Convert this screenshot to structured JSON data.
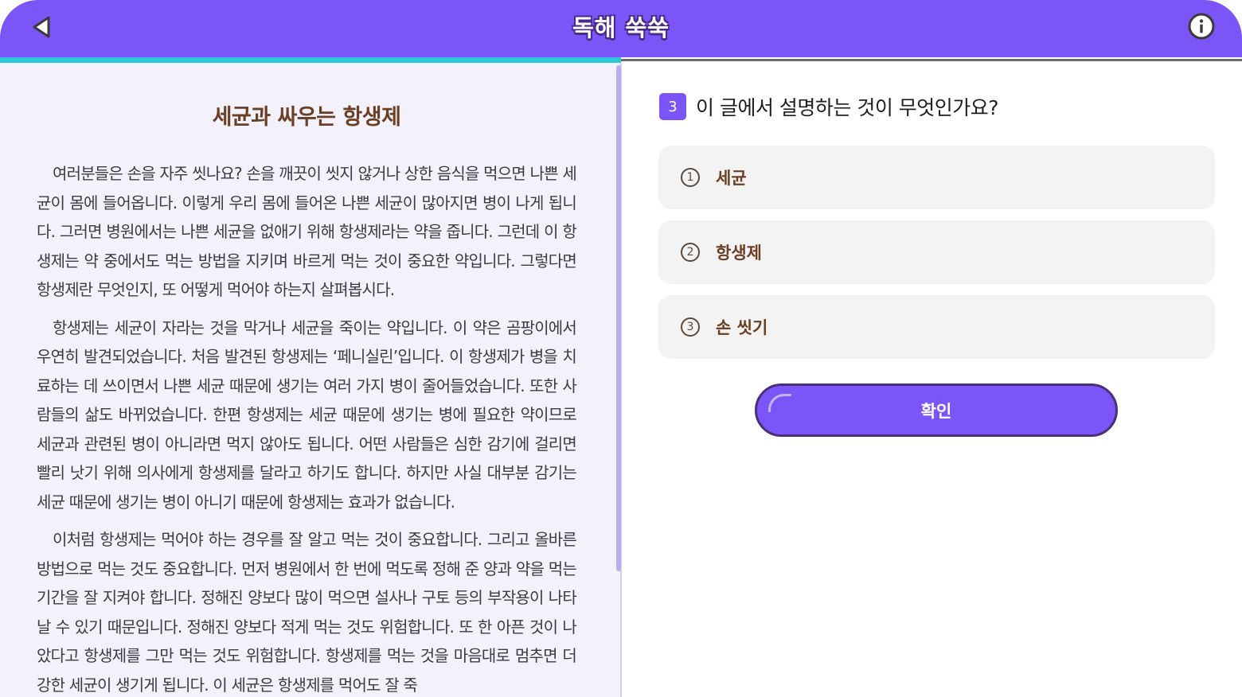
{
  "header": {
    "title": "독해 쑥쑥",
    "back_icon": "back-arrow-icon",
    "info_icon": "info-icon"
  },
  "progress": {
    "fraction": 0.5
  },
  "colors": {
    "accent": "#7b55f8",
    "progress": "#2ec9d9",
    "passage_title": "#6b3f23",
    "passage_bg": "#f3f1fb"
  },
  "passage": {
    "title": "세균과 싸우는 항생제",
    "paragraphs": [
      "여러분들은 손을 자주 씻나요? 손을 깨끗이 씻지 않거나 상한 음식을 먹으면 나쁜 세균이 몸에 들어옵니다. 이렇게 우리 몸에 들어온 나쁜 세균이 많아지면 병이 나게 됩니다. 그러면 병원에서는 나쁜 세균을 없애기 위해 항생제라는 약을 줍니다. 그런데 이 항생제는 약 중에서도 먹는 방법을 지키며 바르게 먹는 것이 중요한 약입니다. 그렇다면 항생제란 무엇인지, 또 어떻게 먹어야 하는지 살펴봅시다.",
      "항생제는 세균이 자라는 것을 막거나 세균을 죽이는 약입니다. 이 약은 곰팡이에서 우연히 발견되었습니다. 처음 발견된 항생제는 ‘페니실린’입니다. 이 항생제가 병을 치료하는 데 쓰이면서 나쁜 세균 때문에 생기는 여러 가지 병이 줄어들었습니다. 또한 사람들의 삶도 바뀌었습니다. 한편 항생제는 세균 때문에 생기는 병에 필요한 약이므로 세균과 관련된 병이 아니라면 먹지 않아도 됩니다. 어떤 사람들은 심한 감기에 걸리면 빨리 낫기 위해 의사에게 항생제를 달라고 하기도 합니다. 하지만 사실 대부분 감기는 세균 때문에 생기는 병이 아니기 때문에 항생제는 효과가 없습니다.",
      "이처럼 항생제는 먹어야 하는 경우를 잘 알고 먹는 것이 중요합니다. 그리고 올바른 방법으로 먹는 것도 중요합니다. 먼저 병원에서 한 번에 먹도록 정해 준 양과 약을 먹는 기간을 잘 지켜야 합니다. 정해진 양보다 많이 먹으면 설사나 구토 등의 부작용이 나타날 수 있기 때문입니다. 정해진 양보다 적게 먹는 것도 위험합니다. 또 한 아픈 것이 나았다고 항생제를 그만 먹는 것도 위험합니다. 항생제를 먹는 것을 마음대로 멈추면 더 강한 세균이 생기게 됩니다. 이 세균은 항생제를 먹어도 잘 죽"
    ]
  },
  "question": {
    "number": "3",
    "text": "이 글에서 설명하는 것이 무엇인가요?",
    "options": [
      {
        "marker": "1",
        "label": "세균"
      },
      {
        "marker": "2",
        "label": "항생제"
      },
      {
        "marker": "3",
        "label": "손 씻기"
      }
    ],
    "confirm_label": "확인"
  }
}
